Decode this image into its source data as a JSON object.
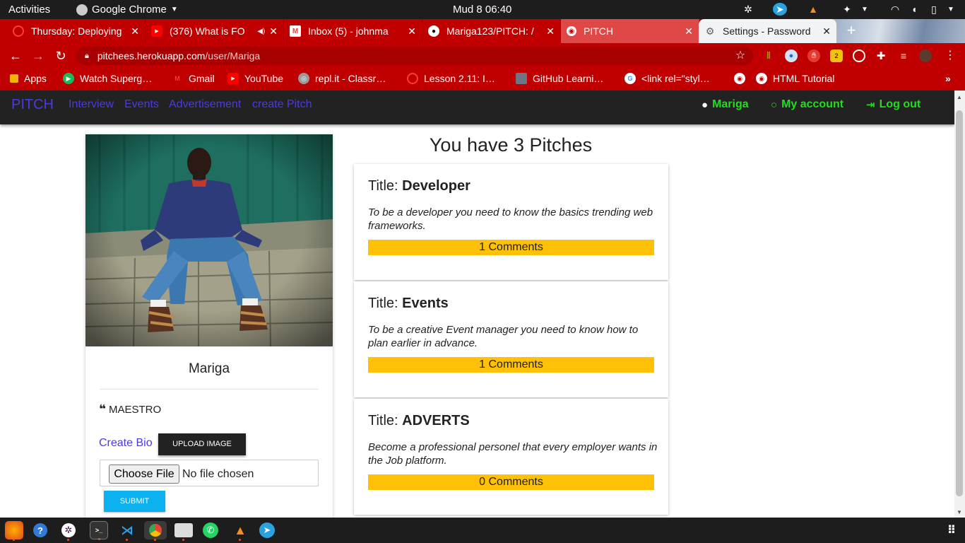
{
  "system": {
    "activities": "Activities",
    "app_name": "Google Chrome",
    "datetime": "Mud 8  06:40"
  },
  "tabs": [
    {
      "title": "Thursday: Deploying",
      "favicon_color": "#ff3b30"
    },
    {
      "title": "(376) What is FO",
      "favicon_color": "#ff0000"
    },
    {
      "title": "Inbox (5) - johnma",
      "favicon_color": "#ea4335"
    },
    {
      "title": "Mariga123/PITCH: /",
      "favicon_color": "#ffffff"
    },
    {
      "title": "PITCH",
      "favicon_color": "#ffffff"
    },
    {
      "title": "Settings - Password",
      "favicon_color": "#5f6368"
    }
  ],
  "address_bar": {
    "host": "pitchees.herokuapp.com",
    "path": "/user/Mariga"
  },
  "bookmarks": [
    {
      "label": "Apps",
      "color": "#f4b400"
    },
    {
      "label": "Watch Superg…",
      "color": "#1db954"
    },
    {
      "label": "Gmail",
      "color": "#ea4335"
    },
    {
      "label": "YouTube",
      "color": "#ff0000"
    },
    {
      "label": "repl.it - Classr…",
      "color": "#999999"
    },
    {
      "label": "Lesson 2.11: I…",
      "color": "#ff3b30"
    },
    {
      "label": "GitHub Learni…",
      "color": "#6e7681"
    },
    {
      "label": "<link rel=\"styl…",
      "color": "#4285f4"
    },
    {
      "label": "HTML Tutorial",
      "color": "#ffffff"
    }
  ],
  "navbar": {
    "brand": "PITCH",
    "links": [
      "Interview",
      "Events",
      "Advertisement",
      "create Pitch"
    ],
    "user": "Mariga",
    "account": "My account",
    "logout": "Log out"
  },
  "profile": {
    "name": "Mariga",
    "bio": "MAESTRO",
    "create_bio": "Create Bio",
    "upload_button": "UPLOAD IMAGE",
    "file_button": "Choose File",
    "file_status": "No file chosen",
    "submit_button": "SUBMIT"
  },
  "pitches": {
    "heading": "You have 3 Pitches",
    "title_prefix": "Title: ",
    "items": [
      {
        "title": "Developer",
        "description": "To be a developer you need to know the basics trending web frameworks.",
        "comments": "1 Comments"
      },
      {
        "title": "Events",
        "description": "To be a creative Event manager you need to know how to plan earlier in advance.",
        "comments": "1 Comments"
      },
      {
        "title": "ADVERTS",
        "description": "Become a professional personel that every employer wants in the Job platform.",
        "comments": "0 Comments"
      }
    ]
  },
  "colors": {
    "chrome_red": "#c00000",
    "nav_link": "#4a3be0",
    "nav_right": "#22dd22",
    "comments_bar": "#ffc107",
    "submit": "#0cb1ef"
  },
  "taskbar": [
    "firefox-icon",
    "help-icon",
    "slack-icon",
    "terminal-icon",
    "vscode-icon",
    "chrome-icon",
    "files-icon",
    "whatsapp-icon",
    "vlc-icon",
    "telegram-icon",
    "app-grid-icon"
  ]
}
